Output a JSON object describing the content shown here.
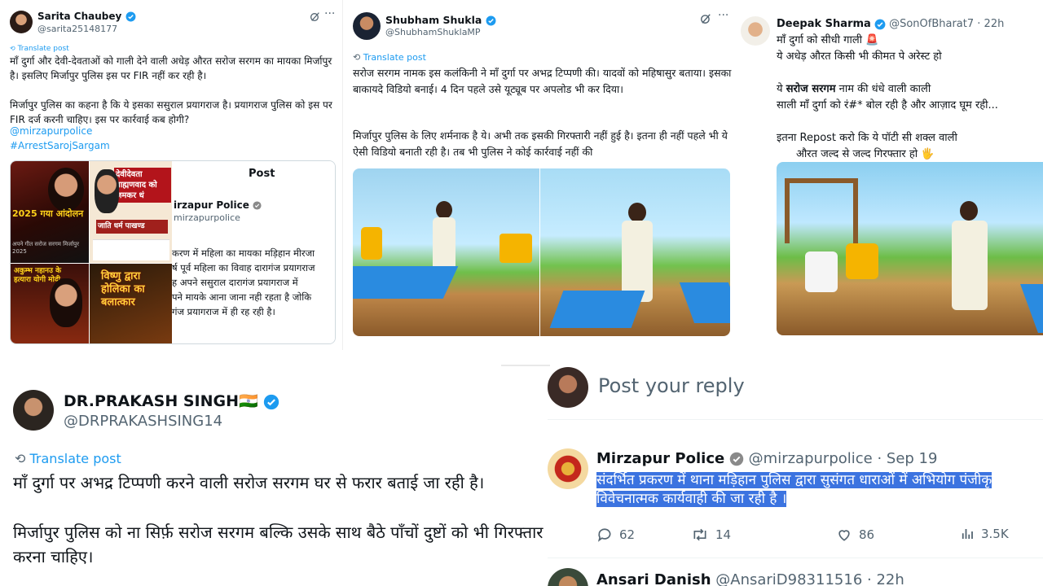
{
  "post1": {
    "name": "Sarita Chaubey",
    "handle": "@sarita25148177",
    "translate": "Translate post",
    "text": "माँ दुर्गा और देवी-देवताओं को गाली देने वाली अधेड़ औरत सरोज सरगम का मायका मिर्जापुर है। इसलिए मिर्जापुर पुलिस इस पर FIR नहीं कर रही है।",
    "text2": "मिर्जापुर पुलिस का कहना है कि ये इसका ससुराल प्रयागराज है। प्रयागराज पुलिस को इस पर FIR दर्ज करनी चाहिए। इस पर कार्रवाई कब होगी?",
    "mention": "@mirzapurpolice",
    "hashtag": "#ArrestSarojSargam",
    "media": {
      "thumb1": "2025 गया आंदोलन",
      "thumb1_sub": "अपने गीत सरोज सरगम मिर्जापुर 2025",
      "thumb2": "देवीदेवता ब्राह्मणवाद को जमकर धं",
      "thumb2_sub": "जाति धर्म पाखण्ड",
      "thumb3": "अकुम्भ नहानउ के हत्यारा योगी मोदी",
      "thumb4": "विष्णु द्वारा होलिका का बलात्कार",
      "embed_title": "Post",
      "embed_name": "irzapur Police",
      "embed_handle": "mirzapurpolice",
      "embed_text": "करण में महिला का मायका मड़िहान मीरजा\nर्ष पूर्व महिला का विवाह दारागंज प्रयागराज\nह अपने ससुराल दारागंज प्रयागराज में\nपने मायके आना जाना नही रहता है जोकि\nगंज प्रयागराज में ही रह रही है।"
    }
  },
  "post2": {
    "name": "Shubham Shukla",
    "handle": "@ShubhamShuklaMP",
    "translate": "Translate post",
    "text": "सरोज सरगम नामक इस कलंकिनी ने माँ दुर्गा पर अभद्र टिप्पणी की। यादवों को महिषासुर बताया। इसका बाकायदे विडियो बनाई। 4 दिन पहले उसे यूट्यूब पर अपलोड भी कर दिया।",
    "text2": "मिर्जापुर पुलिस के लिए शर्मनाक है ये। अभी तक इसकी गिरफ्तारी नहीं हुई है। इतना ही नहीं पहले भी ये ऐसी विडियो बनाती रही है। तब भी पुलिस ने कोई कार्रवाई नहीं की"
  },
  "post3": {
    "name": "Deepak Sharma",
    "handle": "@SonOfBharat7",
    "time": "· 22h",
    "line1": "माँ दुर्गा को सीधी गाली 🚨",
    "line2": "ये अधेड़ औरत किसी भी कीमत पे अरेस्ट हो",
    "line3_pre": "ये ",
    "line3_bold": "सरोज सरगम",
    "line3_post": " नाम की धंधे वाली काली",
    "line4": "साली माँ दुर्गा को रं#* बोल रही है और आज़ाद घूम रही...",
    "line5": "इतना Repost करो कि ये पॉटी सी शक्ल वाली",
    "line6": "औरत जल्द से जल्द गिरफ्तार हो 🖐"
  },
  "post4": {
    "name": "DR.PRAKASH SINGH🇮🇳",
    "handle": "@DRPRAKASHSING14",
    "translate": "Translate post",
    "text": "माँ दुर्गा पर अभद्र टिप्पणी करने वाली सरोज सरगम घर से फरार बताई जा रही है।",
    "text2": "मिर्जापुर पुलिस को ना सिर्फ़ सरोज सरगम बल्कि उसके साथ बैठे पाँचों दुष्टों को भी गिरफ्तार करना चाहिए।"
  },
  "post5": {
    "reply_placeholder": "Post your reply",
    "name": "Mirzapur Police",
    "handle": "@mirzapurpolice",
    "time": "· Sep 19",
    "text1": "संदर्भित प्रकरण में थाना मड़िहान पुलिस द्वारा सुसंगत धाराओं में अभियोग पंजीकृ",
    "text2": "विवेचनात्मक कार्यवाही की जा रही है ।",
    "replies": "62",
    "reposts": "14",
    "likes": "86",
    "views": "3.5K",
    "next_name": "Ansari Danish",
    "next_handle": "@AnsariD98311516",
    "next_time": "· 22h"
  },
  "colors": {
    "link": "#1d9bf0",
    "verified": "#1d9bf0",
    "muted": "#536471",
    "highlight": "#3b73e0"
  }
}
